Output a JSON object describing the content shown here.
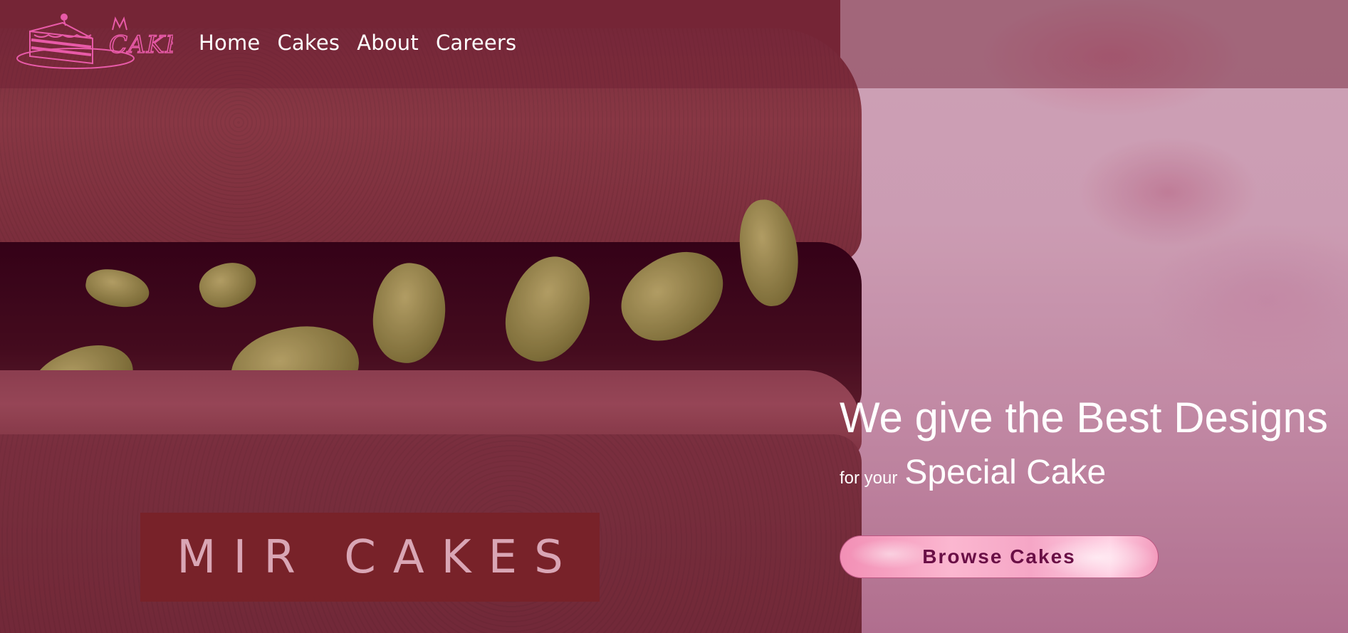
{
  "header": {
    "logo_text": "MIR CAKES",
    "nav": [
      {
        "label": "Home"
      },
      {
        "label": "Cakes"
      },
      {
        "label": "About"
      },
      {
        "label": "Careers"
      }
    ]
  },
  "hero": {
    "brand": "MIR CAKES",
    "headline": "We give the Best Designs",
    "sub_small": "for your",
    "sub_big": "Special Cake",
    "cta_label": "Browse Cakes"
  },
  "colors": {
    "logo_pink": "#e85aa8",
    "cta_text": "#6a0f46",
    "brand_box": "#78222a"
  },
  "icons": {
    "logo": "cake-slice-icon"
  }
}
